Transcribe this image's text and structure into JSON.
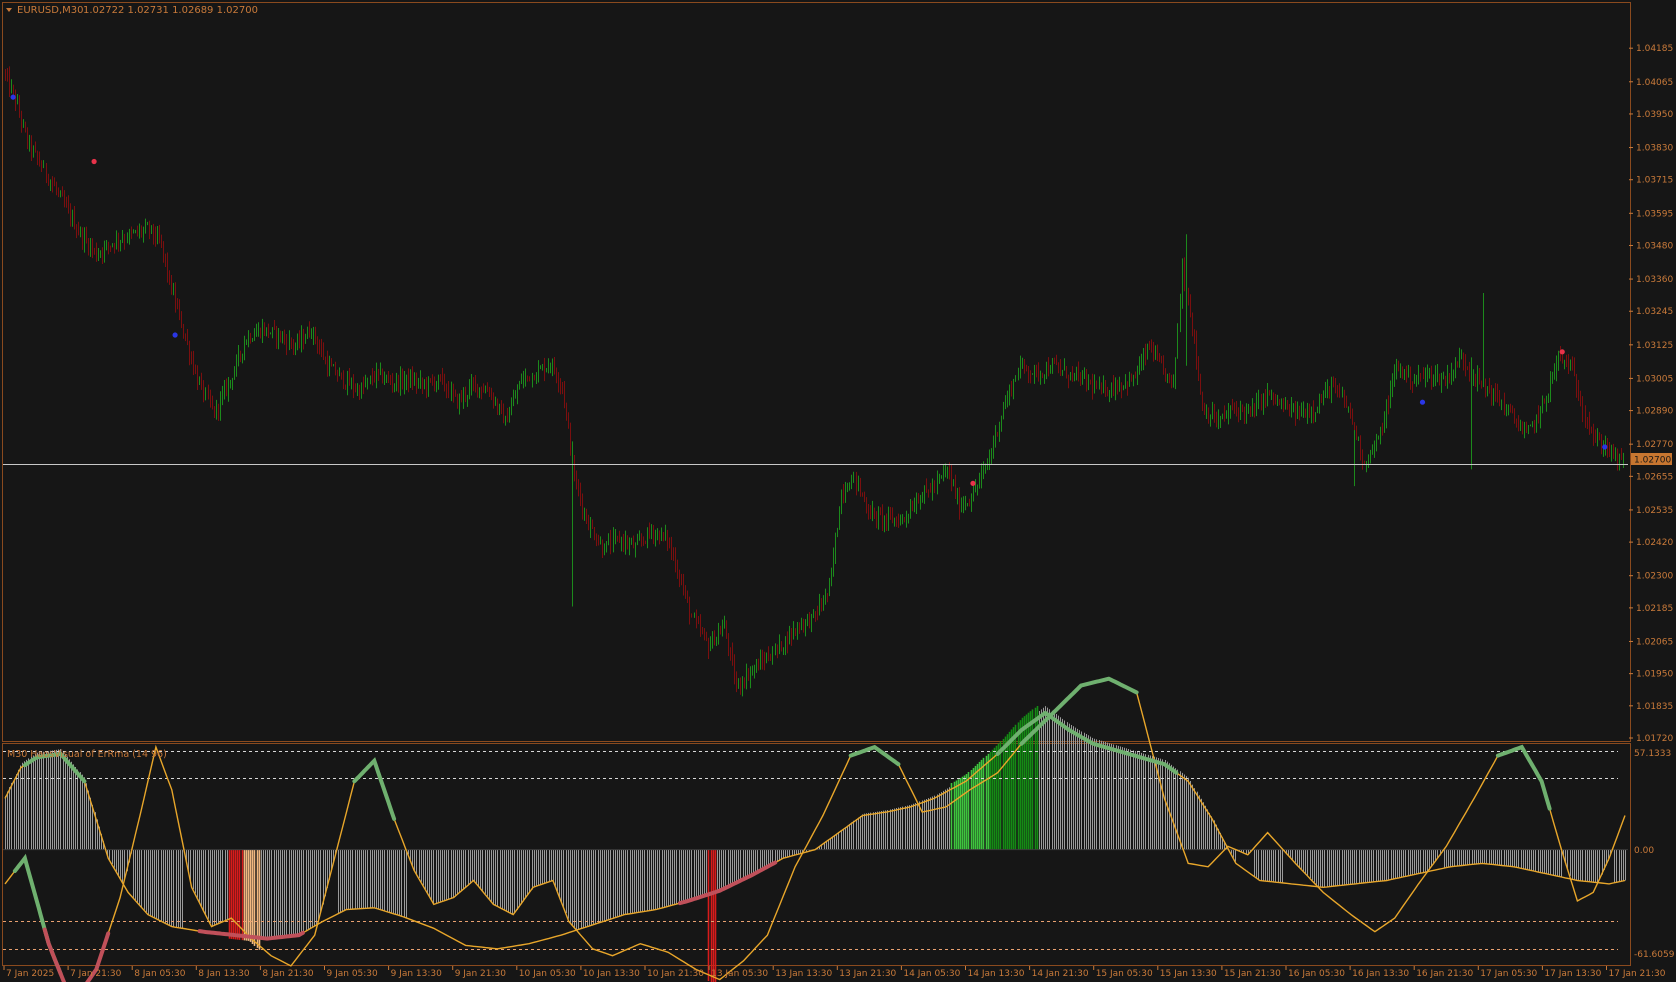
{
  "header": {
    "symbol_tf": "EURUSD,M30",
    "ohlc": "1.02722 1.02731 1.02689 1.02700"
  },
  "indicator": {
    "title": "M30 HaosVisual of ErRma (14 96)",
    "scale_top": "57.1333",
    "scale_zero": "0.00",
    "scale_bottom": "-61.6059"
  },
  "current_price": "1.02700",
  "colors": {
    "background": "#161616",
    "frame": "#8a4a1e",
    "axis_text": "#c97a3a",
    "bull": "#1c8a1c",
    "bear": "#7a0f0f",
    "price_line": "#c8c8c8",
    "price_tag_bg": "#c77630",
    "signal_line": "#e8a62a",
    "dot_red": "#e8334a",
    "dot_blue": "#2a36e6",
    "arc_green": "#6fb06f",
    "arc_red": "#c0505a",
    "hist_grey": "#9a9a9a",
    "hist_green_light": "#3ec43e",
    "hist_green_dark": "#158a15",
    "hist_red": "#d81b1b",
    "hist_orange": "#f0b880"
  },
  "chart_data": [
    {
      "type": "candlestick",
      "title": "EURUSD,M30",
      "ylim": [
        1.0172,
        1.0425
      ],
      "y_ticks": [
        "1.04185",
        "1.04065",
        "1.03950",
        "1.03830",
        "1.03715",
        "1.03595",
        "1.03480",
        "1.03360",
        "1.03245",
        "1.03125",
        "1.03005",
        "1.02890",
        "1.02770",
        "1.02655",
        "1.02535",
        "1.02420",
        "1.02300",
        "1.02185",
        "1.02065",
        "1.01950",
        "1.01835",
        "1.01720"
      ],
      "x_ticks": [
        "7 Jan 2025",
        "7 Jan 21:30",
        "8 Jan 05:30",
        "8 Jan 13:30",
        "8 Jan 21:30",
        "9 Jan 05:30",
        "9 Jan 13:30",
        "9 Jan 21:30",
        "10 Jan 05:30",
        "10 Jan 13:30",
        "10 Jan 21:30",
        "13 Jan 05:30",
        "13 Jan 13:30",
        "13 Jan 21:30",
        "14 Jan 05:30",
        "14 Jan 13:30",
        "14 Jan 21:30",
        "15 Jan 05:30",
        "15 Jan 13:30",
        "15 Jan 21:30",
        "16 Jan 05:30",
        "16 Jan 13:30",
        "16 Jan 21:30",
        "17 Jan 05:30",
        "17 Jan 13:30",
        "17 Jan 21:30"
      ],
      "close_path": [
        [
          0,
          1.041
        ],
        [
          6,
          1.04
        ],
        [
          12,
          1.0385
        ],
        [
          20,
          1.0375
        ],
        [
          28,
          1.0365
        ],
        [
          38,
          1.0352
        ],
        [
          46,
          1.0345
        ],
        [
          56,
          1.035
        ],
        [
          64,
          1.0352
        ],
        [
          72,
          1.0354
        ],
        [
          78,
          1.0348
        ],
        [
          82,
          1.0335
        ],
        [
          88,
          1.032
        ],
        [
          96,
          1.03
        ],
        [
          104,
          1.0288
        ],
        [
          112,
          1.03
        ],
        [
          120,
          1.0315
        ],
        [
          128,
          1.0318
        ],
        [
          136,
          1.0316
        ],
        [
          144,
          1.0312
        ],
        [
          152,
          1.0318
        ],
        [
          160,
          1.0305
        ],
        [
          168,
          1.03
        ],
        [
          176,
          1.0296
        ],
        [
          184,
          1.0302
        ],
        [
          192,
          1.0299
        ],
        [
          200,
          1.03
        ],
        [
          208,
          1.0298
        ],
        [
          216,
          1.03
        ],
        [
          224,
          1.0292
        ],
        [
          232,
          1.0298
        ],
        [
          240,
          1.0296
        ],
        [
          248,
          1.0285
        ],
        [
          256,
          1.03
        ],
        [
          264,
          1.0303
        ],
        [
          270,
          1.0306
        ],
        [
          276,
          1.0298
        ],
        [
          282,
          1.0265
        ],
        [
          288,
          1.025
        ],
        [
          296,
          1.024
        ],
        [
          304,
          1.0243
        ],
        [
          312,
          1.024
        ],
        [
          320,
          1.0246
        ],
        [
          328,
          1.0243
        ],
        [
          334,
          1.023
        ],
        [
          340,
          1.0215
        ],
        [
          348,
          1.0205
        ],
        [
          356,
          1.0212
        ],
        [
          362,
          1.019
        ],
        [
          368,
          1.0195
        ],
        [
          376,
          1.02
        ],
        [
          384,
          1.0205
        ],
        [
          392,
          1.0212
        ],
        [
          400,
          1.0215
        ],
        [
          408,
          1.0225
        ],
        [
          414,
          1.026
        ],
        [
          420,
          1.0265
        ],
        [
          428,
          1.0252
        ],
        [
          436,
          1.025
        ],
        [
          444,
          1.025
        ],
        [
          452,
          1.0258
        ],
        [
          460,
          1.0262
        ],
        [
          466,
          1.0268
        ],
        [
          472,
          1.0255
        ],
        [
          478,
          1.0258
        ],
        [
          486,
          1.027
        ],
        [
          494,
          1.029
        ],
        [
          502,
          1.0305
        ],
        [
          510,
          1.0302
        ],
        [
          518,
          1.0305
        ],
        [
          526,
          1.0302
        ],
        [
          534,
          1.03
        ],
        [
          542,
          1.0296
        ],
        [
          550,
          1.0298
        ],
        [
          558,
          1.03
        ],
        [
          566,
          1.0312
        ],
        [
          572,
          1.0304
        ],
        [
          578,
          1.0298
        ],
        [
          582,
          1.034
        ],
        [
          586,
          1.0325
        ],
        [
          592,
          1.029
        ],
        [
          600,
          1.0285
        ],
        [
          608,
          1.029
        ],
        [
          616,
          1.0288
        ],
        [
          624,
          1.0295
        ],
        [
          632,
          1.029
        ],
        [
          640,
          1.0288
        ],
        [
          648,
          1.029
        ],
        [
          656,
          1.0298
        ],
        [
          664,
          1.029
        ],
        [
          672,
          1.027
        ],
        [
          680,
          1.028
        ],
        [
          688,
          1.0305
        ],
        [
          696,
          1.03
        ],
        [
          704,
          1.0302
        ],
        [
          712,
          1.03
        ],
        [
          720,
          1.0308
        ],
        [
          728,
          1.03
        ],
        [
          736,
          1.0295
        ],
        [
          744,
          1.0288
        ],
        [
          752,
          1.028
        ],
        [
          760,
          1.029
        ],
        [
          768,
          1.0308
        ],
        [
          774,
          1.0305
        ],
        [
          780,
          1.029
        ],
        [
          786,
          1.0278
        ],
        [
          792,
          1.0276
        ],
        [
          797,
          1.0271
        ]
      ],
      "red_dots": [
        [
          44,
          1.0378
        ],
        [
          478,
          1.0263
        ],
        [
          769,
          1.031
        ]
      ],
      "blue_dots": [
        [
          4,
          1.0401
        ],
        [
          84,
          1.0316
        ],
        [
          700,
          1.0292
        ],
        [
          790,
          1.0276
        ]
      ]
    },
    {
      "type": "line",
      "title": "M30 HaosVisual of ErRma (14 96)",
      "ylim": [
        -61.6059,
        57.1333
      ],
      "osc_path": [
        [
          0,
          -20
        ],
        [
          10,
          -5
        ],
        [
          22,
          -55
        ],
        [
          34,
          -90
        ],
        [
          46,
          -70
        ],
        [
          58,
          -28
        ],
        [
          68,
          20
        ],
        [
          76,
          60
        ],
        [
          84,
          35
        ],
        [
          94,
          -22
        ],
        [
          104,
          -45
        ],
        [
          114,
          -40
        ],
        [
          124,
          -52
        ],
        [
          134,
          -62
        ],
        [
          144,
          -68
        ],
        [
          156,
          -50
        ],
        [
          166,
          -5
        ],
        [
          176,
          40
        ],
        [
          186,
          52
        ],
        [
          196,
          18
        ],
        [
          206,
          -12
        ],
        [
          216,
          -32
        ],
        [
          226,
          -28
        ],
        [
          236,
          -18
        ],
        [
          246,
          -32
        ],
        [
          256,
          -38
        ],
        [
          266,
          -22
        ],
        [
          276,
          -18
        ],
        [
          284,
          -42
        ],
        [
          296,
          -58
        ],
        [
          306,
          -62
        ],
        [
          320,
          -55
        ],
        [
          334,
          -60
        ],
        [
          348,
          -70
        ],
        [
          360,
          -76
        ],
        [
          372,
          -65
        ],
        [
          384,
          -50
        ],
        [
          398,
          -10
        ],
        [
          412,
          20
        ],
        [
          426,
          55
        ],
        [
          438,
          60
        ],
        [
          450,
          50
        ],
        [
          462,
          22
        ],
        [
          474,
          25
        ],
        [
          486,
          35
        ],
        [
          500,
          45
        ],
        [
          512,
          62
        ],
        [
          528,
          80
        ],
        [
          542,
          96
        ],
        [
          556,
          100
        ],
        [
          570,
          92
        ],
        [
          584,
          30
        ],
        [
          596,
          -8
        ],
        [
          606,
          -10
        ],
        [
          616,
          2
        ],
        [
          626,
          -3
        ],
        [
          636,
          10
        ],
        [
          650,
          -8
        ],
        [
          664,
          -25
        ],
        [
          678,
          -38
        ],
        [
          690,
          -48
        ],
        [
          700,
          -40
        ],
        [
          712,
          -20
        ],
        [
          726,
          2
        ],
        [
          740,
          30
        ],
        [
          752,
          55
        ],
        [
          764,
          60
        ],
        [
          774,
          40
        ],
        [
          784,
          0
        ],
        [
          792,
          -30
        ],
        [
          800,
          -25
        ],
        [
          808,
          -5
        ],
        [
          816,
          20
        ]
      ],
      "sig_path": [
        [
          0,
          30
        ],
        [
          8,
          48
        ],
        [
          16,
          54
        ],
        [
          28,
          56
        ],
        [
          40,
          40
        ],
        [
          52,
          -5
        ],
        [
          62,
          -25
        ],
        [
          72,
          -38
        ],
        [
          84,
          -45
        ],
        [
          100,
          -48
        ],
        [
          116,
          -50
        ],
        [
          132,
          -52
        ],
        [
          148,
          -50
        ],
        [
          160,
          -42
        ],
        [
          172,
          -35
        ],
        [
          186,
          -34
        ],
        [
          200,
          -39
        ],
        [
          216,
          -46
        ],
        [
          232,
          -56
        ],
        [
          248,
          -58
        ],
        [
          264,
          -55
        ],
        [
          280,
          -50
        ],
        [
          296,
          -44
        ],
        [
          312,
          -38
        ],
        [
          328,
          -35
        ],
        [
          344,
          -30
        ],
        [
          360,
          -24
        ],
        [
          376,
          -15
        ],
        [
          392,
          -5
        ],
        [
          408,
          0
        ],
        [
          420,
          10
        ],
        [
          432,
          20
        ],
        [
          444,
          22
        ],
        [
          456,
          25
        ],
        [
          468,
          30
        ],
        [
          484,
          40
        ],
        [
          500,
          56
        ],
        [
          512,
          70
        ],
        [
          524,
          80
        ],
        [
          536,
          70
        ],
        [
          548,
          62
        ],
        [
          560,
          58
        ],
        [
          572,
          54
        ],
        [
          584,
          50
        ],
        [
          596,
          40
        ],
        [
          608,
          18
        ],
        [
          620,
          -8
        ],
        [
          632,
          -18
        ],
        [
          648,
          -20
        ],
        [
          664,
          -22
        ],
        [
          680,
          -20
        ],
        [
          696,
          -18
        ],
        [
          712,
          -14
        ],
        [
          728,
          -10
        ],
        [
          744,
          -8
        ],
        [
          760,
          -10
        ],
        [
          776,
          -14
        ],
        [
          792,
          -18
        ],
        [
          808,
          -20
        ],
        [
          816,
          -18
        ]
      ],
      "levels": [
        58,
        42,
        -42,
        -58
      ]
    }
  ]
}
